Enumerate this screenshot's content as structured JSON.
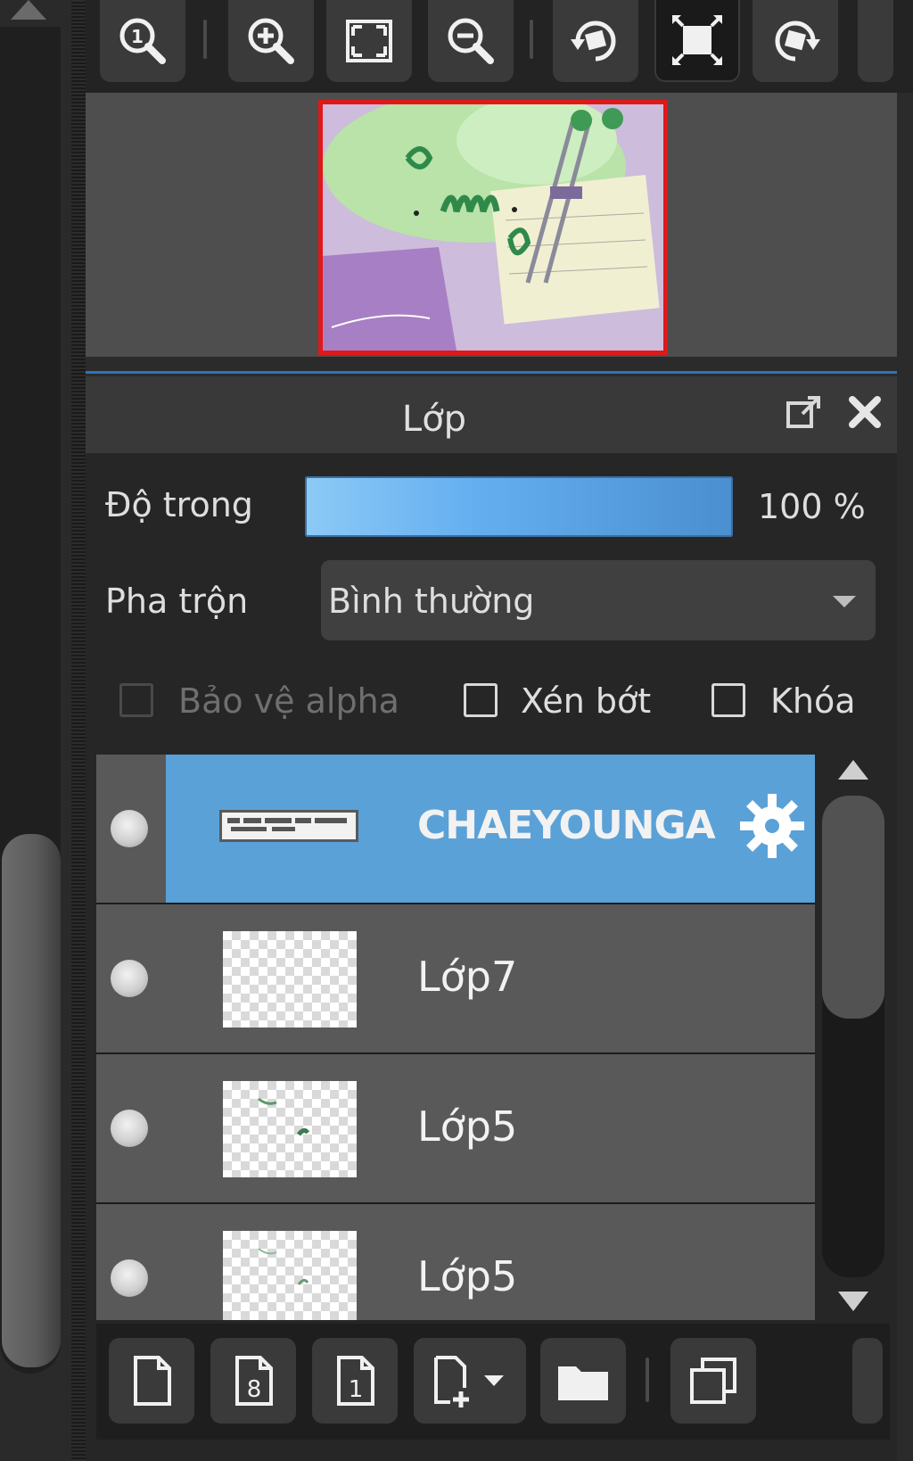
{
  "navigator_toolbar": {
    "buttons": [
      {
        "icon": "zoom-actual-size-icon"
      },
      {
        "icon": "zoom-in-icon"
      },
      {
        "icon": "fit-to-window-icon"
      },
      {
        "icon": "zoom-out-icon"
      },
      {
        "icon": "rotate-left-icon"
      },
      {
        "icon": "reset-rotation-icon",
        "active": true
      },
      {
        "icon": "rotate-right-icon"
      }
    ]
  },
  "layer_panel": {
    "title": "Lớp",
    "opacity": {
      "label": "Độ trong",
      "value_text": "100 %",
      "value": 100
    },
    "blend": {
      "label": "Pha trộn",
      "value": "Bình thường"
    },
    "checkboxes": {
      "protect_alpha": {
        "label": "Bảo vệ alpha",
        "checked": false,
        "enabled": false
      },
      "clipping": {
        "label": "Xén bớt",
        "checked": false
      },
      "lock": {
        "label": "Khóa",
        "checked": false
      }
    },
    "layers": [
      {
        "name": "CHAEYOUNGA",
        "selected": true,
        "type": "text"
      },
      {
        "name": "Lớp7",
        "selected": false
      },
      {
        "name": "Lớp5",
        "selected": false
      },
      {
        "name": "Lớp5",
        "selected": false
      }
    ]
  },
  "bottom_toolbar": {
    "buttons": [
      {
        "icon": "new-layer-icon"
      },
      {
        "icon": "new-8bit-layer-icon"
      },
      {
        "icon": "new-1bit-layer-icon"
      },
      {
        "icon": "add-layer-dropdown-icon"
      },
      {
        "icon": "new-folder-icon"
      },
      {
        "icon": "duplicate-layer-icon"
      }
    ]
  },
  "colors": {
    "accent": "#5aa1d8",
    "preview_border": "#e01818",
    "opacity_bar": "#64aef0"
  }
}
